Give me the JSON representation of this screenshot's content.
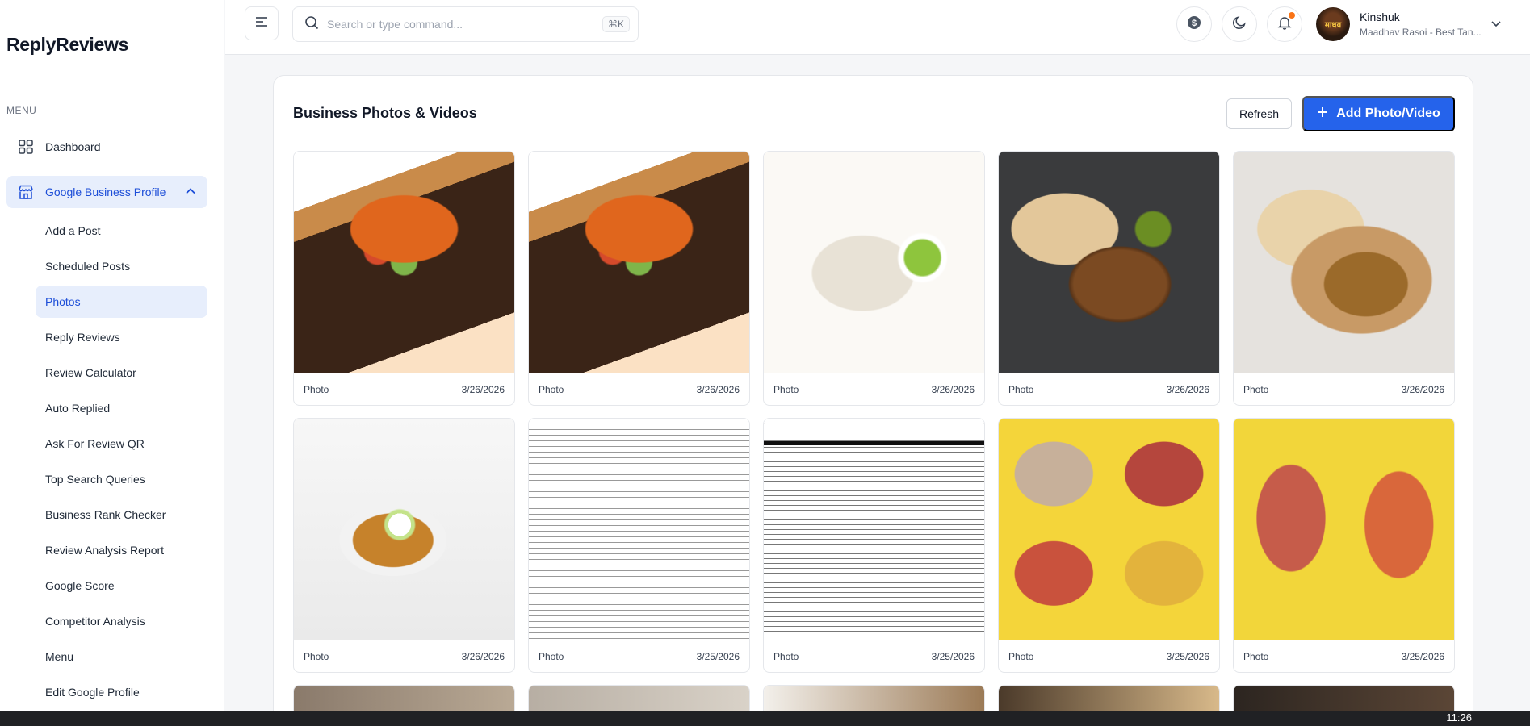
{
  "brand": "ReplyReviews",
  "sidebar": {
    "menu_label": "MENU",
    "dashboard": "Dashboard",
    "gbp": "Google Business Profile",
    "items": [
      "Add a Post",
      "Scheduled Posts",
      "Photos",
      "Reply Reviews",
      "Review Calculator",
      "Auto Replied",
      "Ask For Review QR",
      "Top Search Queries",
      "Business Rank Checker",
      "Review Analysis Report",
      "Google Score",
      "Competitor Analysis",
      "Menu",
      "Edit Google Profile"
    ],
    "active_item": "Photos"
  },
  "header": {
    "search_placeholder": "Search or type command...",
    "shortcut": "⌘K",
    "user_name": "Kinshuk",
    "user_business": "Maadhav Rasoi - Best Tan...",
    "avatar_text": "माधव"
  },
  "main": {
    "title": "Business Photos & Videos",
    "refresh_label": "Refresh",
    "add_label": "Add Photo/Video",
    "photos": [
      {
        "type": "Photo",
        "date": "3/26/2026"
      },
      {
        "type": "Photo",
        "date": "3/26/2026"
      },
      {
        "type": "Photo",
        "date": "3/26/2026"
      },
      {
        "type": "Photo",
        "date": "3/26/2026"
      },
      {
        "type": "Photo",
        "date": "3/26/2026"
      },
      {
        "type": "Photo",
        "date": "3/26/2026"
      },
      {
        "type": "Photo",
        "date": "3/25/2026"
      },
      {
        "type": "Photo",
        "date": "3/25/2026"
      },
      {
        "type": "Photo",
        "date": "3/25/2026"
      },
      {
        "type": "Photo",
        "date": "3/25/2026"
      }
    ]
  },
  "taskbar": {
    "clock": "11:26"
  },
  "colors": {
    "accent": "#2563eb",
    "active_bg": "#e7eefc",
    "active_text": "#1d4ed8",
    "notif": "#f97316"
  }
}
